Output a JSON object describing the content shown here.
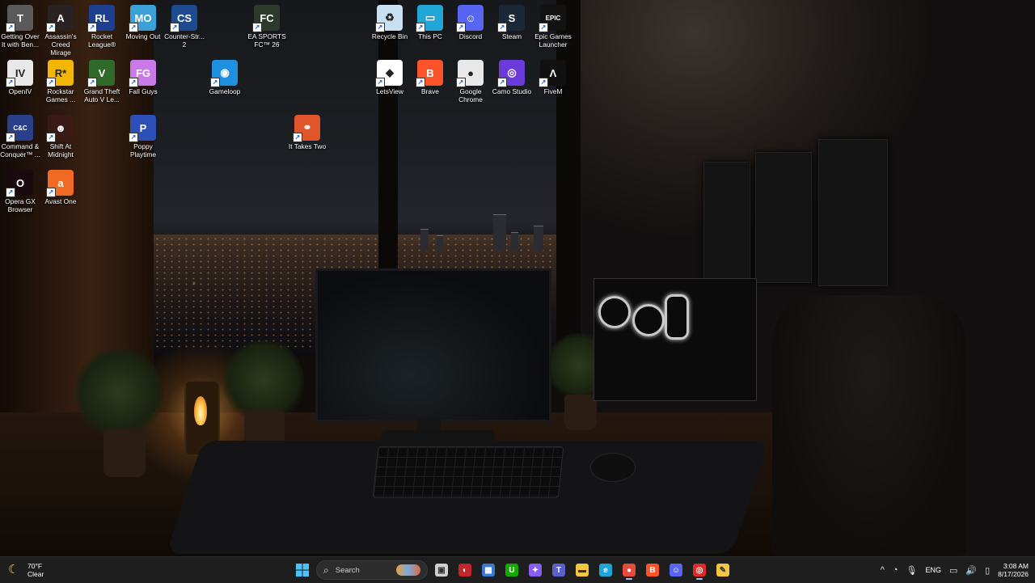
{
  "desktop": {
    "icons": [
      {
        "label": "Getting Over\nIt with Ben...",
        "icon": "hammer-icon",
        "color": "#5a5a5a",
        "glyph": "T"
      },
      {
        "label": "Assassin's\nCreed Mirage",
        "icon": "assassins-creed-icon",
        "color": "#2a2222",
        "glyph": "A"
      },
      {
        "label": "Rocket\nLeague®",
        "icon": "rocket-league-icon",
        "color": "#1d3f8f",
        "glyph": "RL"
      },
      {
        "label": "Moving Out",
        "icon": "moving-out-icon",
        "color": "#3aa0d8",
        "glyph": "MO"
      },
      {
        "label": "Counter-Str...\n2",
        "icon": "counter-strike-icon",
        "color": "#1e4a8f",
        "glyph": "CS"
      },
      {
        "label": "EA SPORTS\nFC™ 26",
        "icon": "ea-sports-fc-icon",
        "color": "#2b3a2a",
        "glyph": "FC"
      },
      {
        "label": "Recycle Bin",
        "icon": "recycle-bin-icon",
        "color": "#c9dff2",
        "glyph": "♻"
      },
      {
        "label": "This PC",
        "icon": "this-pc-icon",
        "color": "#22a6d8",
        "glyph": "▭"
      },
      {
        "label": "Discord",
        "icon": "discord-icon",
        "color": "#5865f2",
        "glyph": "☺"
      },
      {
        "label": "Steam",
        "icon": "steam-icon",
        "color": "#1b2838",
        "glyph": "S"
      },
      {
        "label": "Epic Games\nLauncher",
        "icon": "epic-games-icon",
        "color": "#121212",
        "glyph": "EPIC"
      },
      {
        "label": "OpenIV",
        "icon": "openiv-icon",
        "color": "#e8e8e8",
        "glyph": "IV"
      },
      {
        "label": "Rockstar\nGames ...",
        "icon": "rockstar-games-icon",
        "color": "#f2b705",
        "glyph": "R*"
      },
      {
        "label": "Grand Theft\nAuto V Le...",
        "icon": "gta-v-icon",
        "color": "#2f6a2a",
        "glyph": "V"
      },
      {
        "label": "Fall Guys",
        "icon": "fall-guys-icon",
        "color": "#c97ae8",
        "glyph": "FG"
      },
      {
        "label": "Gameloop",
        "icon": "gameloop-icon",
        "color": "#1f8fe0",
        "glyph": "◉"
      },
      {
        "label": "LetsView",
        "icon": "letsview-icon",
        "color": "#ffffff",
        "glyph": "◆"
      },
      {
        "label": "Brave",
        "icon": "brave-icon",
        "color": "#fb542b",
        "glyph": "B"
      },
      {
        "label": "Google\nChrome",
        "icon": "chrome-icon",
        "color": "#e8e8e8",
        "glyph": "●"
      },
      {
        "label": "Camo Studio",
        "icon": "camo-studio-icon",
        "color": "#6a3bd8",
        "glyph": "◎"
      },
      {
        "label": "FiveM",
        "icon": "fivem-icon",
        "color": "#111111",
        "glyph": "Λ"
      },
      {
        "label": "Command &\nConquer™ ...",
        "icon": "command-conquer-icon",
        "color": "#2a3f8a",
        "glyph": "C&C"
      },
      {
        "label": "Shift At\nMidnight",
        "icon": "shift-at-midnight-icon",
        "color": "#3a1a14",
        "glyph": "☻"
      },
      {
        "label": "Poppy\nPlaytime",
        "icon": "poppy-playtime-icon",
        "color": "#2c4fb8",
        "glyph": "P"
      },
      {
        "label": "It Takes Two",
        "icon": "it-takes-two-icon",
        "color": "#e0562a",
        "glyph": "⚭"
      },
      {
        "label": "Opera GX\nBrowser",
        "icon": "opera-gx-icon",
        "color": "#1a0a10",
        "glyph": "O"
      },
      {
        "label": "Avast One",
        "icon": "avast-one-icon",
        "color": "#f06a23",
        "glyph": "a"
      }
    ]
  },
  "taskbar": {
    "weather": {
      "temp": "70°F",
      "condition": "Clear",
      "icon": "moon-icon"
    },
    "search_placeholder": "Search",
    "apps": [
      {
        "name": "task-view",
        "icon": "task-view-icon",
        "color": "#cfcfcf",
        "glyph": "▣"
      },
      {
        "name": "app-red",
        "icon": "app-icon-red",
        "color": "#c0262a",
        "glyph": "◐"
      },
      {
        "name": "copilot-store",
        "icon": "store-icon",
        "color": "#3a78d8",
        "glyph": "▦"
      },
      {
        "name": "upwork",
        "icon": "upwork-icon",
        "color": "#14a800",
        "glyph": "U"
      },
      {
        "name": "copilot",
        "icon": "copilot-icon",
        "color": "#8a5cf0",
        "glyph": "✦"
      },
      {
        "name": "teams",
        "icon": "teams-icon",
        "color": "#5b5fc7",
        "glyph": "T"
      },
      {
        "name": "file-explorer",
        "icon": "folder-icon",
        "color": "#f4c542",
        "glyph": "▬"
      },
      {
        "name": "edge",
        "icon": "edge-icon",
        "color": "#1fa4d8",
        "glyph": "e"
      },
      {
        "name": "chrome",
        "icon": "chrome-icon",
        "color": "#e54a3a",
        "glyph": "●"
      },
      {
        "name": "brave",
        "icon": "brave-icon",
        "color": "#fb542b",
        "glyph": "B"
      },
      {
        "name": "discord",
        "icon": "discord-icon",
        "color": "#5865f2",
        "glyph": "☺"
      },
      {
        "name": "recorder",
        "icon": "recorder-icon",
        "color": "#e02a2a",
        "glyph": "◎"
      },
      {
        "name": "notes",
        "icon": "sticky-notes-icon",
        "color": "#f4c542",
        "glyph": "✎"
      }
    ],
    "tray": {
      "language": "ENG",
      "time": "3:08 AM",
      "date": "8/17/2026"
    }
  }
}
